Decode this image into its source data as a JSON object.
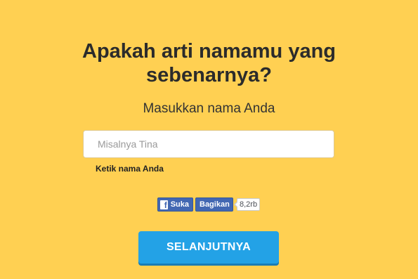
{
  "page": {
    "title": "Apakah arti namamu yang sebenarnya?",
    "subtitle": "Masukkan nama Anda"
  },
  "form": {
    "name_placeholder": "Misalnya Tina",
    "name_value": "",
    "helper_text": "Ketik nama Anda",
    "submit_label": "SELANJUTNYA"
  },
  "social": {
    "like_label": "Suka",
    "share_label": "Bagikan",
    "count": "8,2rb",
    "logo_glyph": "f",
    "icon": "facebook-icon"
  },
  "colors": {
    "background": "#FFD052",
    "button": "#23A2E6",
    "facebook": "#4267B2"
  }
}
